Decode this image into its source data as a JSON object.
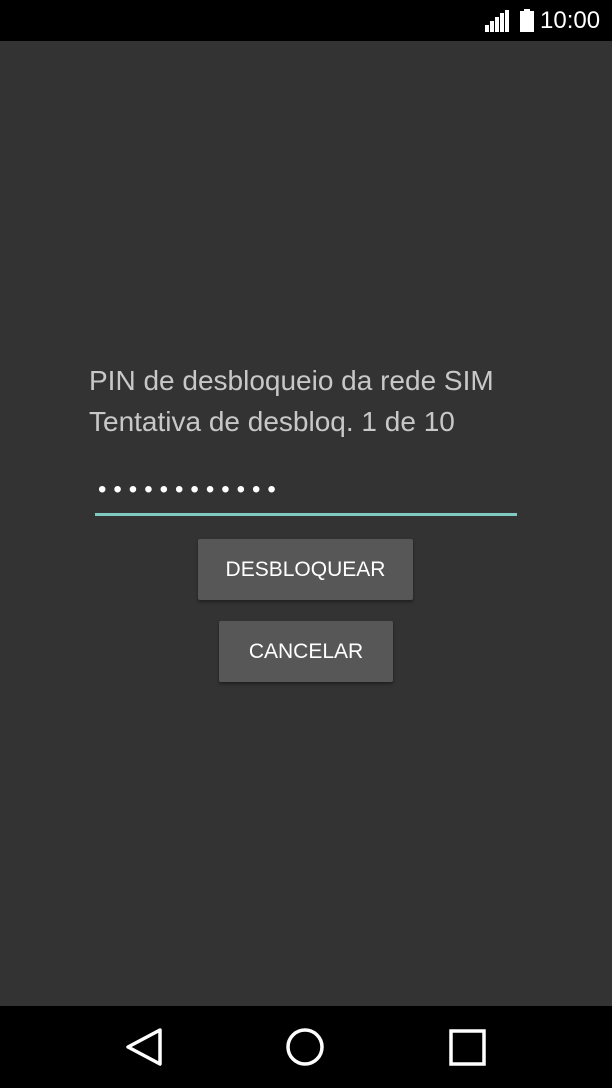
{
  "status_bar": {
    "time": "10:00",
    "icons": [
      "signal-icon",
      "battery-icon"
    ]
  },
  "prompt": {
    "title": "PIN de desbloqueio da rede SIM",
    "attempts": "Tentativa de desbloq. 1 de 10"
  },
  "pin_field": {
    "value": "••••••••••••"
  },
  "buttons": {
    "unlock_label": "DESBLOQUEAR",
    "cancel_label": "CANCELAR"
  },
  "nav_bar": {
    "icons": [
      "back-icon",
      "home-icon",
      "recents-icon"
    ]
  },
  "colors": {
    "background": "#333333",
    "accent": "#7fcbc4",
    "button": "#575757"
  }
}
